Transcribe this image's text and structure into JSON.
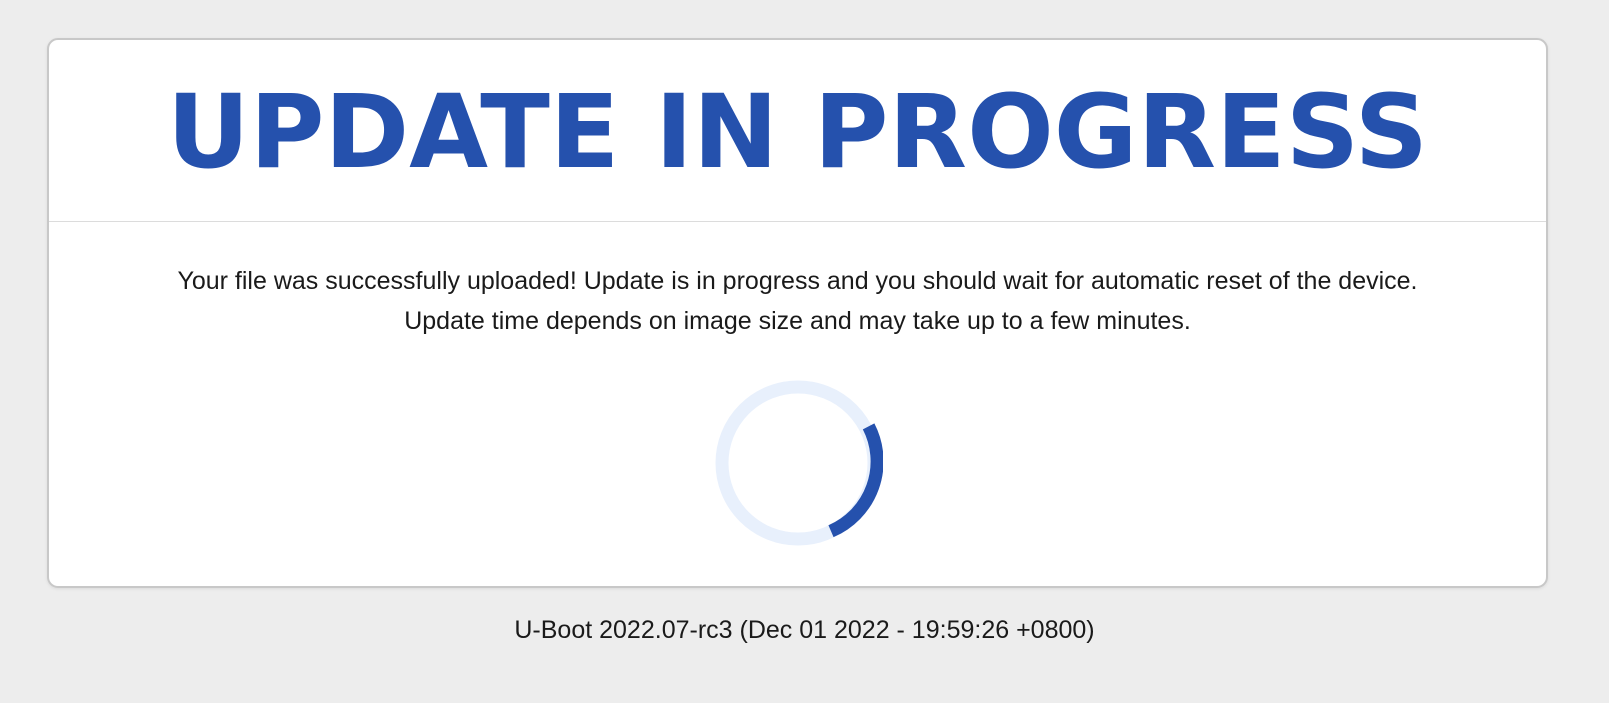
{
  "header": {
    "title": "UPDATE IN PROGRESS"
  },
  "message": {
    "line1": "Your file was successfully uploaded! Update is in progress and you should wait for automatic reset of the device.",
    "line2": "Update time depends on image size and may take up to a few minutes."
  },
  "spinner": {
    "icon": "loading-spinner-icon",
    "track_color": "#e8f0fc",
    "arc_color": "#2551ad"
  },
  "footer": {
    "version": "U-Boot 2022.07-rc3 (Dec 01 2022 - 19:59:26 +0800)"
  },
  "colors": {
    "accent": "#2551ad",
    "background": "#ededed",
    "card": "#ffffff"
  }
}
